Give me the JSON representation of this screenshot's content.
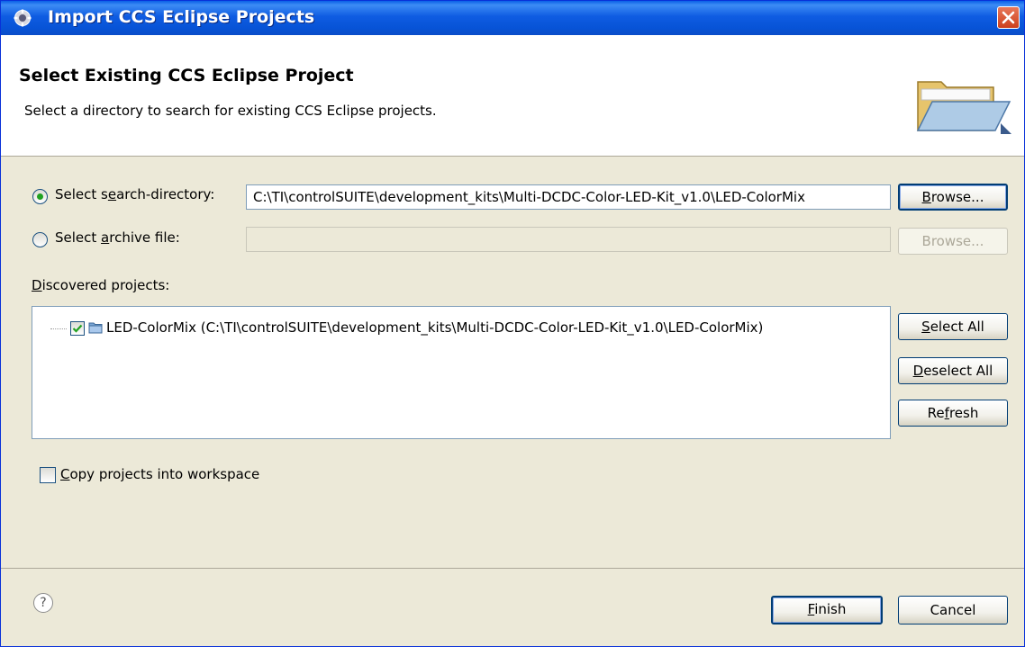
{
  "window": {
    "title": "Import CCS Eclipse Projects"
  },
  "header": {
    "title": "Select Existing CCS Eclipse Project",
    "description": "Select a directory to search for existing CCS Eclipse projects."
  },
  "search_directory": {
    "label_pre": "Select s",
    "label_mnemonic": "e",
    "label_post": "arch-directory:",
    "value": "C:\\TI\\controlSUITE\\development_kits\\Multi-DCDC-Color-LED-Kit_v1.0\\LED-ColorMix",
    "selected": true,
    "browse_mnemonic": "B",
    "browse_rest": "rowse..."
  },
  "archive_file": {
    "label_pre": "Select ",
    "label_mnemonic": "a",
    "label_post": "rchive file:",
    "value": "",
    "selected": false,
    "browse_label": "Browse..."
  },
  "discovered": {
    "label_mnemonic": "D",
    "label_rest": "iscovered projects:",
    "projects": [
      {
        "name": "LED-ColorMix",
        "path": "(C:\\TI\\controlSUITE\\development_kits\\Multi-DCDC-Color-LED-Kit_v1.0\\LED-ColorMix)",
        "checked": true
      }
    ]
  },
  "side_buttons": {
    "select_all_mnemonic": "S",
    "select_all_rest": "elect All",
    "deselect_all_mnemonic": "D",
    "deselect_all_rest": "eselect All",
    "refresh_pre": "Re",
    "refresh_mnemonic": "f",
    "refresh_post": "resh"
  },
  "copy_option": {
    "mnemonic": "C",
    "rest": "opy projects into workspace",
    "checked": false
  },
  "footer": {
    "help_glyph": "?",
    "finish_mnemonic": "F",
    "finish_rest": "inish",
    "cancel_label": "Cancel"
  },
  "colors": {
    "titlebar": "#0753d6",
    "dialog_background": "#ece9d8",
    "radio_dot": "#21a121",
    "checkmark": "#21a121"
  },
  "icons": {
    "title": "eclipse-gear-icon",
    "close": "close-icon",
    "header": "open-folder-icon",
    "project": "project-folder-icon",
    "help": "help-icon"
  }
}
